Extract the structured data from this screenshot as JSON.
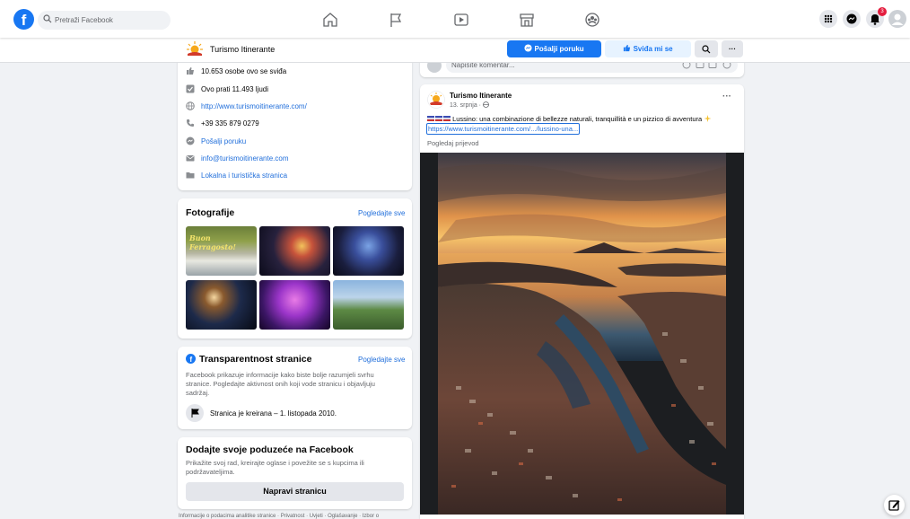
{
  "topbar": {
    "logo": "f",
    "search_placeholder": "Pretraži Facebook",
    "notification_count": "3",
    "icons": [
      "facebook-logo-icon",
      "search-icon",
      "home-icon",
      "flag-icon",
      "video-icon",
      "marketplace-icon",
      "groups-icon",
      "menu-grid-icon",
      "messenger-icon",
      "bell-icon",
      "profile-avatar-icon"
    ]
  },
  "page_header": {
    "name": "Turismo Itinerante",
    "message_button": "Pošalji poruku",
    "like_button": "Sviđa mi se",
    "more_label": "···"
  },
  "about": {
    "likes": "10.653 osobe ovo se sviđa",
    "followers": "Ovo prati 11.493 ljudi",
    "website": "http://www.turismoitinerante.com/",
    "phone": "+39 335 879 0279",
    "send_message": "Pošalji poruku",
    "email": "info@turismoitinerante.com",
    "category": "Lokalna i turistička stranica"
  },
  "photos": {
    "title": "Fotografije",
    "see_all": "Pogledajte sve",
    "thumb1_text": "Buon Ferragosto!"
  },
  "transparency": {
    "title": "Transparentnost stranice",
    "see_all": "Pogledajte sve",
    "desc_line1": "Facebook prikazuje informacije kako biste bolje razumjeli svrhu",
    "desc_line2": "stranice. Pogledajte aktivnost onih koji vode stranicu i objavljuju",
    "desc_line3": "sadržaj.",
    "created": "Stranica je kreirana – 1. listopada 2010."
  },
  "business": {
    "title": "Dodajte svoje poduzeće na Facebook",
    "desc_line1": "Prikažite svoj rad, kreirajte oglase i povežite se s kupcima ili",
    "desc_line2": "podržavateljima.",
    "button": "Napravi stranicu"
  },
  "footer": {
    "text": "Informacije o podacima analitike stranice · Privatnost · Uvjeti · Oglašavanje · Izbor o"
  },
  "comment": {
    "placeholder": "Napišite komentar..."
  },
  "post": {
    "author": "Turismo Itinerante",
    "date": "13. srpnja · ",
    "more": "···",
    "text": "Lussino: una combinazione di bellezze naturali, tranquillità e un pizzico di avventura",
    "link": "https://www.turismoitinerante.com/.../lussino-una...",
    "translate": "Pogledaj prijevod"
  },
  "colors": {
    "brand": "#1877f2",
    "link": "#216fdb",
    "background": "#f0f2f5"
  }
}
